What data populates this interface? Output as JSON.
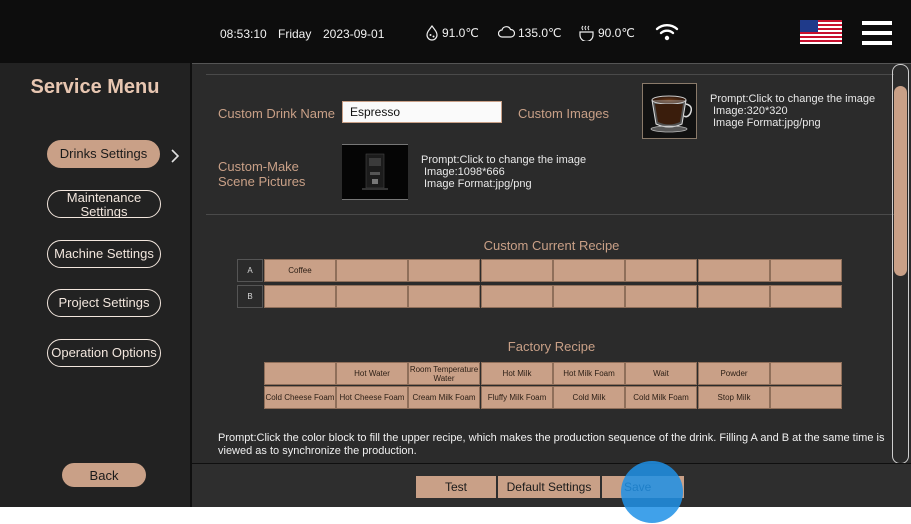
{
  "status_bar": {
    "time": "08:53:10",
    "day": "Friday",
    "date": "2023-09-01",
    "temp1": "91.0℃",
    "temp2": "135.0℃",
    "temp3": "90.0℃",
    "icons": [
      "boiler-icon",
      "steam-icon",
      "water-icon",
      "wifi-icon",
      "us-flag-icon",
      "menu-icon"
    ]
  },
  "sidebar": {
    "title": "Service Menu",
    "items": [
      {
        "label": "Drinks Settings",
        "active": true
      },
      {
        "label": "Maintenance Settings",
        "active": false
      },
      {
        "label": "Machine Settings",
        "active": false
      },
      {
        "label": "Project Settings",
        "active": false
      },
      {
        "label": "Operation Options",
        "active": false
      }
    ],
    "back_label": "Back"
  },
  "main": {
    "custom_drink_name_label": "Custom Drink Name",
    "custom_drink_name_value": "Espresso",
    "custom_images_label": "Custom Images",
    "custom_images_prompt": [
      "Prompt:Click to change the image",
      "Image:320*320",
      "Image Format:jpg/png"
    ],
    "scene_label_line1": "Custom-Make",
    "scene_label_line2": "Scene Pictures",
    "scene_prompt": [
      "Prompt:Click to change the image",
      "Image:1098*666",
      "Image Format:jpg/png"
    ],
    "current_recipe_title": "Custom Current Recipe",
    "current_recipe_rows": [
      {
        "label": "A",
        "cells": [
          "Coffee",
          "",
          "",
          "",
          "",
          "",
          "",
          ""
        ]
      },
      {
        "label": "B",
        "cells": [
          "",
          "",
          "",
          "",
          "",
          "",
          "",
          ""
        ]
      }
    ],
    "factory_recipe_title": "Factory Recipe",
    "factory_recipe_rows": [
      [
        "",
        "Hot Water",
        "Room Temperature Water",
        "Hot Milk",
        "Hot Milk Foam",
        "Wait",
        "Powder",
        ""
      ],
      [
        "Cold Cheese Foam",
        "Hot Cheese Foam",
        "Cream Milk Foam",
        "Fluffy Milk Foam",
        "Cold Milk",
        "Cold Milk Foam",
        "Stop Milk",
        ""
      ]
    ],
    "bottom_prompt": "Prompt:Click the color block to fill the upper recipe, which makes the production sequence of the drink. Filling A and B at the same time is viewed as to synchronize the production."
  },
  "bottom_bar": {
    "test_label": "Test",
    "default_settings_label": "Default Settings",
    "save_label": "Save"
  },
  "colors": {
    "accent": "#c9a087",
    "background": "#0f0f0f",
    "panel": "#2b2b2b",
    "touch_indicator": "#1e90e6"
  }
}
